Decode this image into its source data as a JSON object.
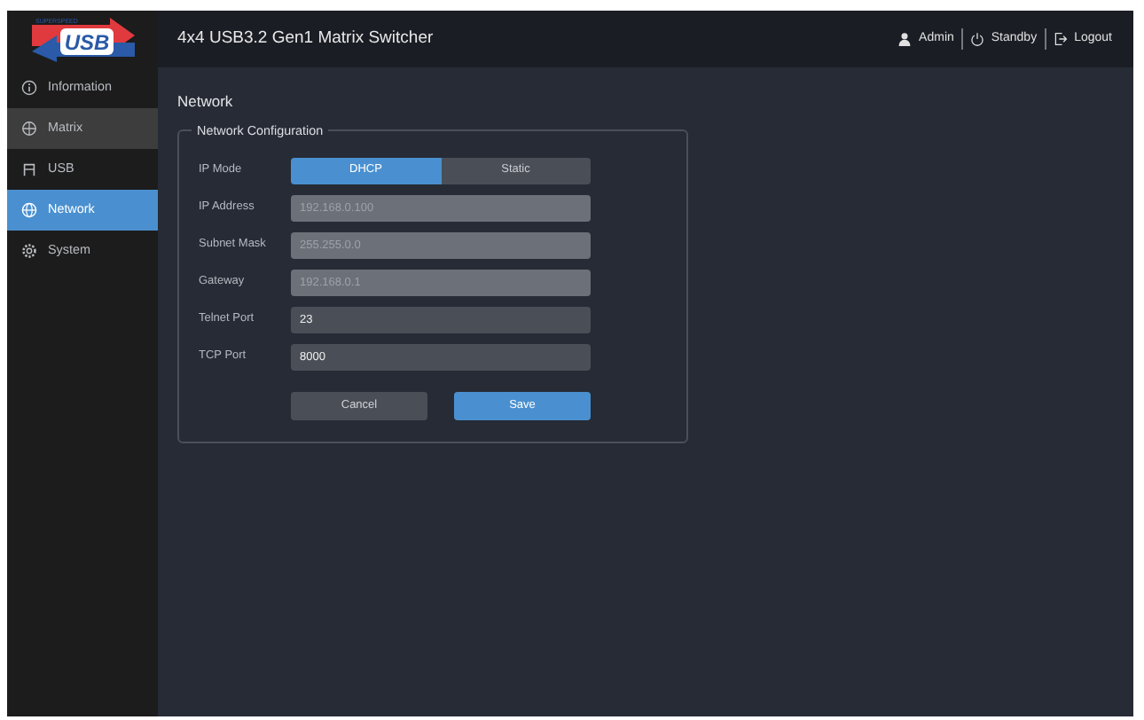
{
  "logo": {
    "tagline": "SUPERSPEED",
    "mark": "USB"
  },
  "header": {
    "title": "4x4 USB3.2 Gen1 Matrix Switcher",
    "actions": [
      {
        "label": "Admin"
      },
      {
        "label": "Standby"
      },
      {
        "label": "Logout"
      }
    ]
  },
  "sidebar": {
    "items": [
      {
        "label": "Information",
        "selected": false,
        "hovered": false
      },
      {
        "label": "Matrix",
        "selected": false,
        "hovered": true
      },
      {
        "label": "USB",
        "selected": false,
        "hovered": false
      },
      {
        "label": "Network",
        "selected": true,
        "hovered": false
      },
      {
        "label": "System",
        "selected": false,
        "hovered": false
      }
    ]
  },
  "page_title": "Network",
  "network_configuration": {
    "legend": "Network Configuration",
    "ip_mode": {
      "label": "IP Mode",
      "options": [
        {
          "label": "DHCP",
          "selected": true
        },
        {
          "label": "Static",
          "selected": false
        }
      ]
    },
    "fields": [
      {
        "label": "IP Address",
        "value": "192.168.0.100",
        "disabled": true
      },
      {
        "label": "Subnet Mask",
        "value": "255.255.0.0",
        "disabled": true
      },
      {
        "label": "Gateway",
        "value": "192.168.0.1",
        "disabled": true
      },
      {
        "label": "Telnet Port",
        "value": "23",
        "disabled": false
      },
      {
        "label": "TCP Port",
        "value": "8000",
        "disabled": false
      }
    ],
    "buttons": [
      {
        "label": "Cancel",
        "kind": "secondary"
      },
      {
        "label": "Save",
        "kind": "primary"
      }
    ]
  }
}
